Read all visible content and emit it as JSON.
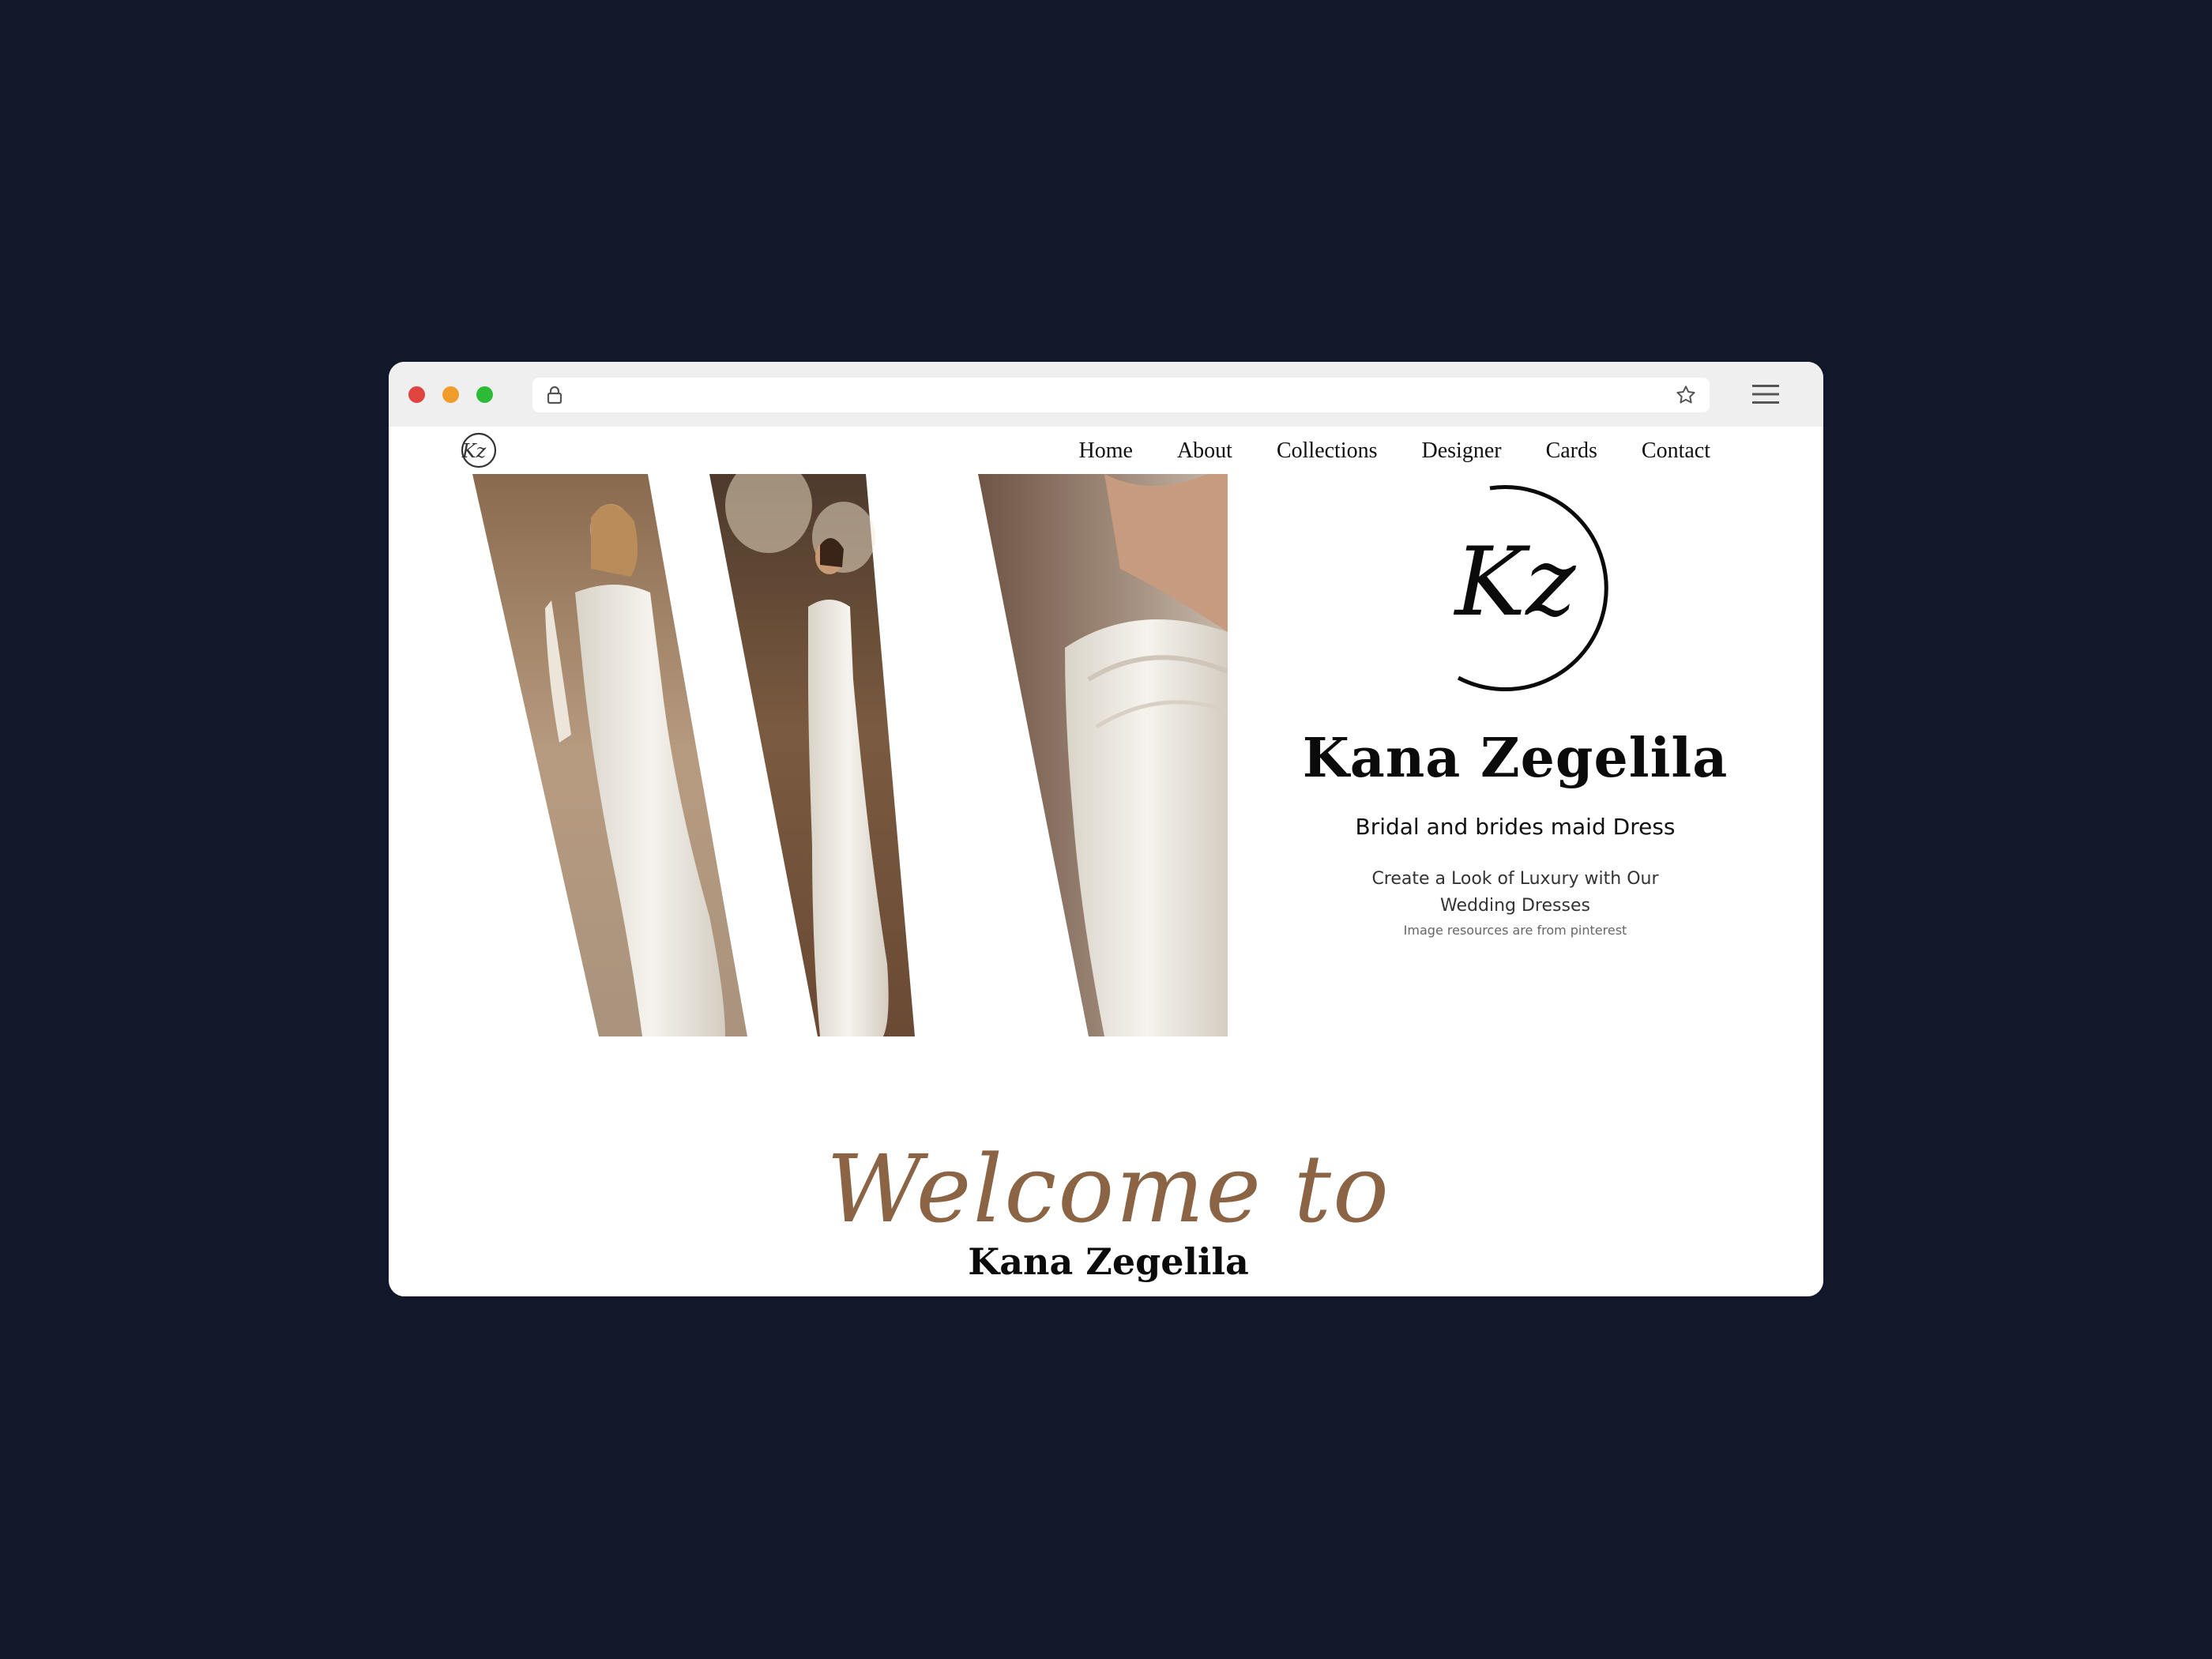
{
  "nav": {
    "logo_text": "Kz",
    "items": [
      "Home",
      "About",
      "Collections",
      "Designer",
      "Cards",
      "Contact"
    ]
  },
  "hero": {
    "logo_text": "Kz",
    "title": "Kana Zegelila",
    "subtitle": "Bridal and brides maid Dress",
    "description": "Create a Look of Luxury with Our Wedding Dresses",
    "note": "Image resources are from pinterest"
  },
  "welcome": {
    "script": "Welcome to",
    "name": "Kana Zegelila"
  },
  "colors": {
    "background": "#12172a",
    "accent_brown": "#8a6445",
    "text_dark": "#0b0b0b"
  }
}
